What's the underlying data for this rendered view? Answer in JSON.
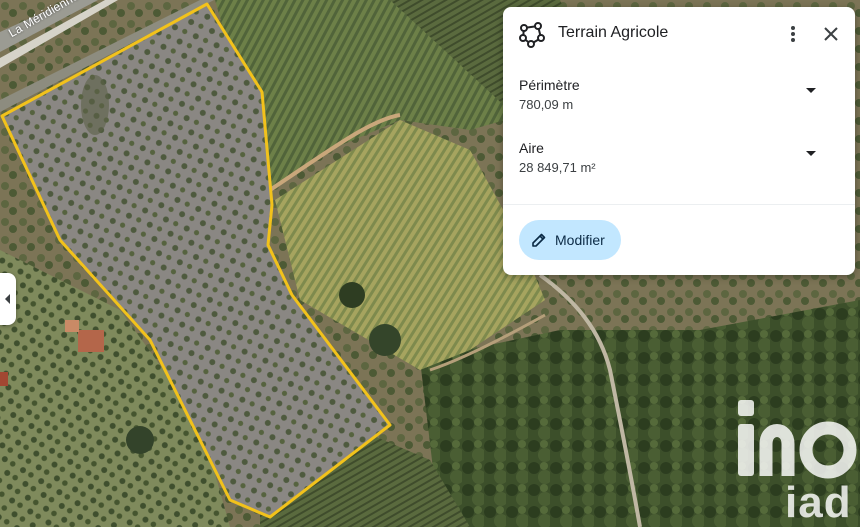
{
  "map": {
    "type": "satellite",
    "road_label": "La Méridienne",
    "parcel_outline_color": "#f2c21b"
  },
  "panel": {
    "title": "Terrain Agricole",
    "title_icon": "polygon-measure-icon",
    "perimeter": {
      "label": "Périmètre",
      "value": "780,09 m"
    },
    "area": {
      "label": "Aire",
      "value": "28 849,71 m²"
    },
    "edit_button_label": "Modifier",
    "accent_color": "#c2e7ff"
  },
  "watermark": {
    "brand": "iad"
  }
}
